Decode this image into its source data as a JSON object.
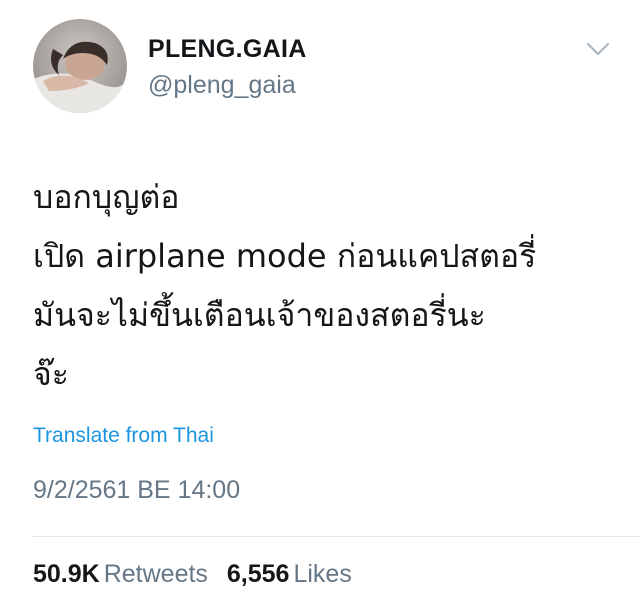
{
  "author": {
    "display_name": "PLENG.GAIA",
    "handle": "@pleng_gaia",
    "menu_icon": "chevron-down-icon"
  },
  "tweet": {
    "lines": [
      "บอกบุญต่อ",
      "เปิด airplane mode ก่อนแคปสตอรี่",
      "มันจะไม่ขึ้นเตือนเจ้าของสตอรี่นะ",
      "จ๊ะ"
    ],
    "translate_label": "Translate from Thai",
    "timestamp": "9/2/2561 BE 14:00"
  },
  "stats": {
    "retweets_count": "50.9K",
    "retweets_label": "Retweets",
    "likes_count": "6,556",
    "likes_label": "Likes"
  },
  "colors": {
    "text": "#14171a",
    "secondary": "#657786",
    "link": "#1b95e0",
    "divider": "#e1e8ed"
  }
}
